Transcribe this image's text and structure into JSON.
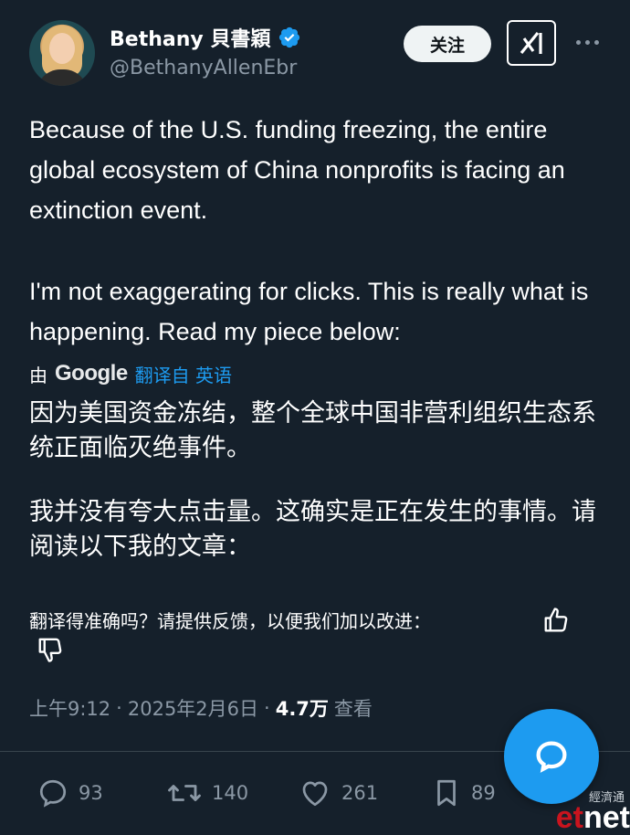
{
  "author": {
    "name": "Bethany 貝書穎",
    "handle": "@BethanyAllenEbr",
    "verified": true
  },
  "header": {
    "follow_label": "关注",
    "grok_icon": "grok-icon",
    "more_icon": "more-dots-icon"
  },
  "tweet": {
    "paragraph_1": "Because of the U.S. funding freezing, the entire global ecosystem of China nonprofits is facing an extinction event.",
    "paragraph_2": "I'm not exaggerating for clicks. This is really what is happening. Read my piece below:"
  },
  "translation": {
    "by_prefix": "由",
    "provider": "Google",
    "source_label": "翻译自 英语",
    "paragraph_1": "因为美国资金冻结，整个全球中国非营利组织生态系统正面临灭绝事件。",
    "paragraph_2": "我并没有夸大点击量。这确实是正在发生的事情。请阅读以下我的文章：",
    "feedback_prompt": "翻译得准确吗？请提供反馈，以便我们加以改进："
  },
  "meta": {
    "time": "上午9:12",
    "date": "2025年2月6日",
    "views_count": "4.7万",
    "views_label": "查看"
  },
  "actions": {
    "replies": "93",
    "retweets": "140",
    "likes": "261",
    "bookmarks": "89"
  },
  "watermark": {
    "top": "經濟通",
    "main_red": "et",
    "main": "net"
  },
  "colors": {
    "background": "#15202b",
    "accent": "#1d9bf0",
    "muted": "#8b98a5"
  }
}
